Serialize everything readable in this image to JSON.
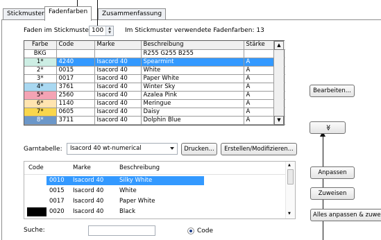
{
  "tabs": [
    {
      "label": "Stickmuster"
    },
    {
      "label": "Fadenfarben"
    },
    {
      "label": "Zusammenfassung"
    }
  ],
  "thread_count": {
    "label": "Faden im Stickmuster:",
    "value": "100"
  },
  "used_colors": {
    "label": "Im Stickmuster verwendete Fadenfarben: 13"
  },
  "grid": {
    "headers": [
      "Farbe",
      "Code",
      "Marke",
      "Beschreibung",
      "Stärke"
    ],
    "rows": [
      {
        "farbe": "BKG",
        "code": "",
        "marke": "",
        "beschreibung": "R255 G255 B255",
        "staerke": "",
        "swatch": "#ffffff",
        "selected": false
      },
      {
        "farbe": "1*",
        "code": "4240",
        "marke": "Isacord 40",
        "beschreibung": "Spearmint",
        "staerke": "A",
        "swatch": "#cdeee4",
        "selected": true
      },
      {
        "farbe": "2*",
        "code": "0015",
        "marke": "Isacord 40",
        "beschreibung": "White",
        "staerke": "A",
        "swatch": "#ffffff",
        "selected": false
      },
      {
        "farbe": "3*",
        "code": "0017",
        "marke": "Isacord 40",
        "beschreibung": "Paper White",
        "staerke": "A",
        "swatch": "#ffffff",
        "selected": false
      },
      {
        "farbe": "4*",
        "code": "3761",
        "marke": "Isacord 40",
        "beschreibung": "Winter Sky",
        "staerke": "A",
        "swatch": "#a9d8f1",
        "selected": false
      },
      {
        "farbe": "5*",
        "code": "2560",
        "marke": "Isacord 40",
        "beschreibung": "Azalea Pink",
        "staerke": "A",
        "swatch": "#f4a3b4",
        "selected": false
      },
      {
        "farbe": "6*",
        "code": "1140",
        "marke": "Isacord 40",
        "beschreibung": "Meringue",
        "staerke": "A",
        "swatch": "#ffe4b0",
        "selected": false
      },
      {
        "farbe": "7*",
        "code": "0605",
        "marke": "Isacord 40",
        "beschreibung": "Daisy",
        "staerke": "A",
        "swatch": "#f9d64c",
        "selected": false
      },
      {
        "farbe": "8*",
        "code": "3711",
        "marke": "Isacord 40",
        "beschreibung": "Dolphin Blue",
        "staerke": "A",
        "swatch": "#6b97c9",
        "selected": false
      }
    ]
  },
  "buttons": {
    "bearbeiten": "Bearbeiten...",
    "expand": "≫",
    "drucken": "Drucken...",
    "erstellen": "Erstellen/Modifizieren...",
    "anpassen": "Anpassen",
    "zuweisen": "Zuweisen",
    "alle": "Alles anpassen & zuweisen"
  },
  "garntabelle": {
    "label": "Garntabelle:",
    "value": "Isacord 40 wt-numerical"
  },
  "list": {
    "headers": [
      "Code",
      "Marke",
      "Beschreibung"
    ],
    "rows": [
      {
        "code": "0010",
        "marke": "Isacord 40",
        "beschreibung": "Silky White",
        "swatch": "#ffffff",
        "selected": true
      },
      {
        "code": "0015",
        "marke": "Isacord 40",
        "beschreibung": "White",
        "swatch": "#ffffff",
        "selected": false
      },
      {
        "code": "0017",
        "marke": "Isacord 40",
        "beschreibung": "Paper White",
        "swatch": "#ffffff",
        "selected": false
      },
      {
        "code": "0020",
        "marke": "Isacord 40",
        "beschreibung": "Black",
        "swatch": "#000000",
        "selected": false
      }
    ]
  },
  "search": {
    "label": "Suche:",
    "value": "",
    "radio_label": "Code"
  },
  "colors": {
    "selection": "#3399ff"
  }
}
